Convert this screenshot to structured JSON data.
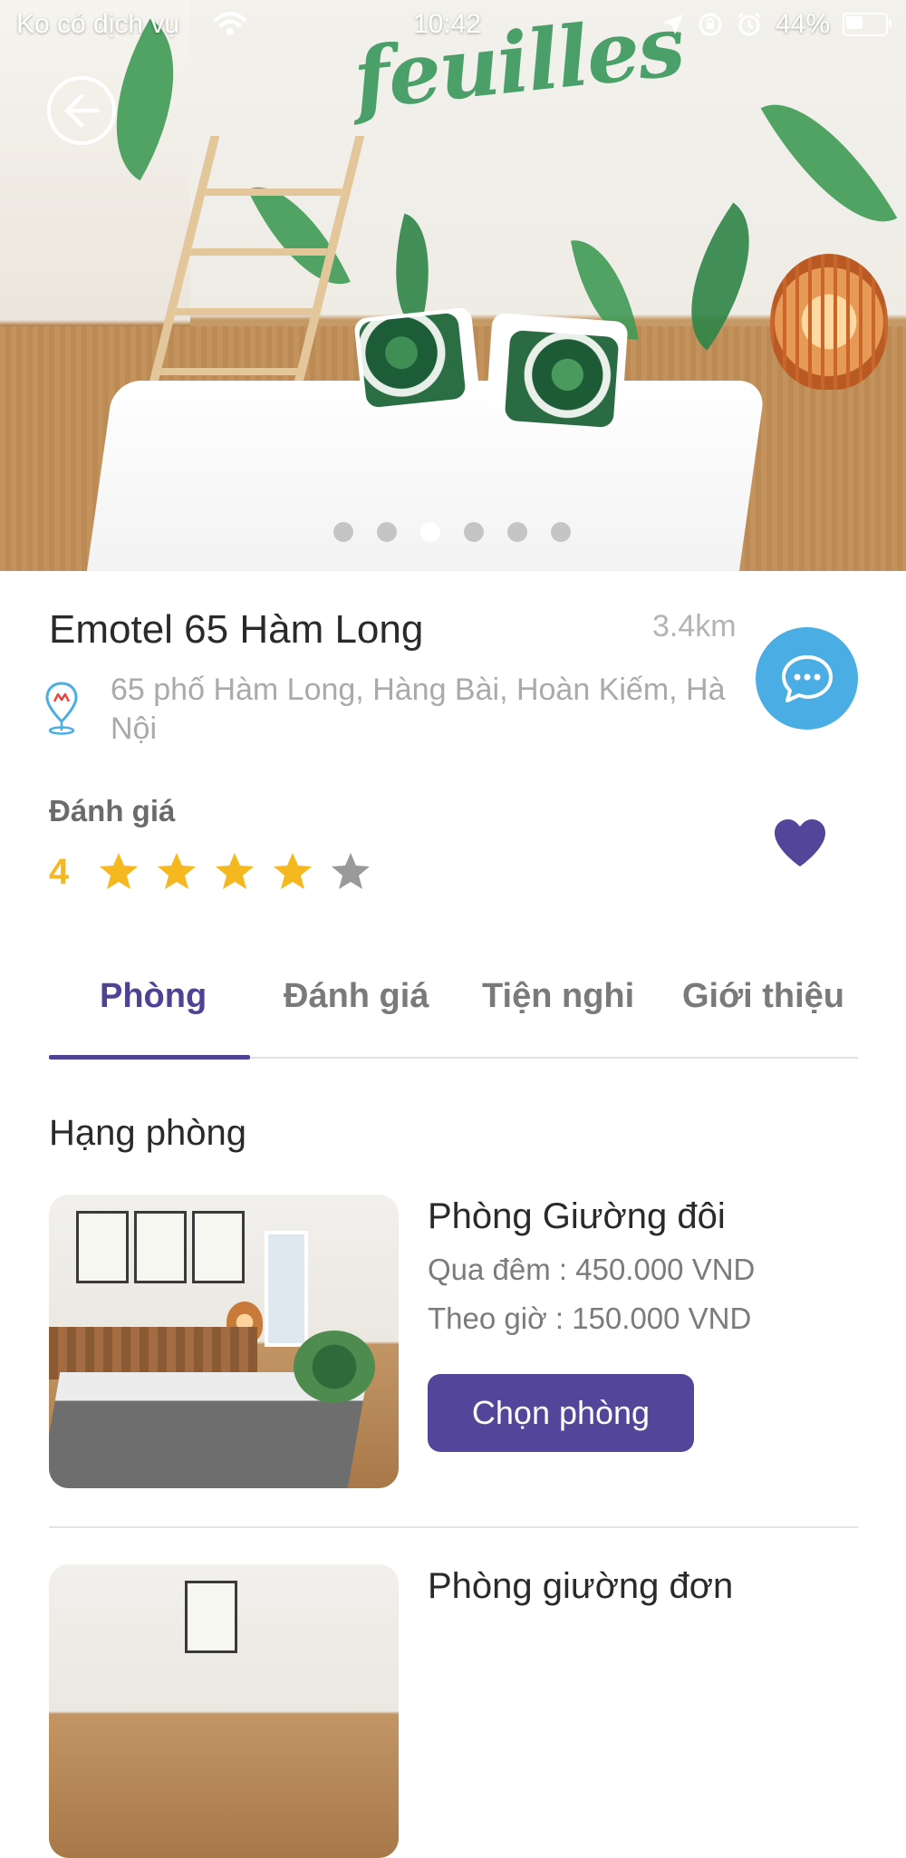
{
  "status_bar": {
    "carrier": "Ko có dịch vụ",
    "time": "10:42",
    "battery": "44%"
  },
  "hero": {
    "brand_text": "feuilles",
    "slide_count": 6,
    "active_slide": 3
  },
  "hotel": {
    "name": "Emotel 65 Hàm Long",
    "distance": "3.4km",
    "address": "65 phố Hàm Long, Hàng Bài, Hoàn Kiếm, Hà Nội"
  },
  "rating": {
    "label": "Đánh giá",
    "value": "4",
    "stars_filled": 4,
    "stars_total": 5
  },
  "tabs": [
    {
      "label": "Phòng",
      "active": true
    },
    {
      "label": "Đánh giá",
      "active": false
    },
    {
      "label": "Tiện nghi",
      "active": false
    },
    {
      "label": "Giới thiệu",
      "active": false
    }
  ],
  "rooms_section": {
    "title": "Hạng phòng",
    "rooms": [
      {
        "name": "Phòng Giường đôi",
        "overnight": "Qua đêm : 450.000 VND",
        "hourly": "Theo giờ : 150.000 VND",
        "button": "Chọn phòng"
      },
      {
        "name": "Phòng giường đơn"
      }
    ]
  },
  "colors": {
    "primary": "#52459a",
    "tab_active": "#4e4296",
    "chat_button": "#4aaee4",
    "star_filled": "#f6b81f",
    "star_empty": "#9a9a9a"
  },
  "icons": {
    "back": "arrow-left-circle-icon",
    "chat": "chat-bubble-icon",
    "location": "map-pin-icon",
    "favorite": "heart-icon",
    "star": "star-icon"
  }
}
